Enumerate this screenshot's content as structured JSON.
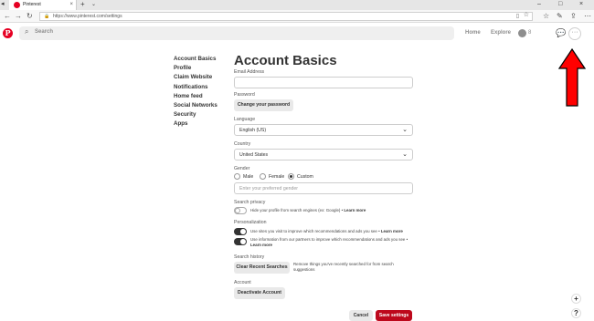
{
  "browser": {
    "tab_title": "Pinterest",
    "tab_close": "×",
    "new_tab": "+",
    "tab_dropdown": "⌄",
    "url": "https://www.pinterest.com/settings",
    "win_min": "–",
    "win_max": "□",
    "win_close": "×"
  },
  "header": {
    "logo_letter": "P",
    "search_placeholder": "Search",
    "nav_home": "Home",
    "nav_explore": "Explore",
    "notif_count": "8",
    "more": "···"
  },
  "sidebar": {
    "items": [
      {
        "label": "Account Basics"
      },
      {
        "label": "Profile"
      },
      {
        "label": "Claim Website"
      },
      {
        "label": "Notifications"
      },
      {
        "label": "Home feed"
      },
      {
        "label": "Social Networks"
      },
      {
        "label": "Security"
      },
      {
        "label": "Apps"
      }
    ]
  },
  "form": {
    "title": "Account Basics",
    "email_label": "Email Address",
    "email_value": "",
    "password_label": "Password",
    "change_password": "Change your password",
    "language_label": "Language",
    "language_value": "English (US)",
    "country_label": "Country",
    "country_value": "United States",
    "gender_label": "Gender",
    "gender_options": [
      "Male",
      "Female",
      "Custom"
    ],
    "gender_selected": "Custom",
    "gender_placeholder": "Enter your preferred gender",
    "search_privacy_label": "Search privacy",
    "search_privacy_text": "Hide your profile from search engines (ex: Google) •",
    "search_privacy_on": false,
    "learn_more": "Learn more",
    "personalization_label": "Personalization",
    "personalization_1_text": "Use sites you visit to improve which recommendations and ads you see •",
    "personalization_1_on": true,
    "personalization_2_text": "Use information from our partners to improve which recommendations and ads you see •",
    "personalization_2_on": true,
    "search_history_label": "Search history",
    "clear_searches": "Clear Recent Searches",
    "clear_searches_desc": "Remove things you've recently searched for from search suggestions",
    "account_label": "Account",
    "deactivate": "Deactivate Account",
    "cancel": "Cancel",
    "save": "Save settings"
  },
  "fabs": {
    "plus": "+",
    "help": "?"
  },
  "colors": {
    "pinterest_red": "#e60023",
    "save_red": "#bd081c",
    "arrow_red": "#ff0000"
  }
}
